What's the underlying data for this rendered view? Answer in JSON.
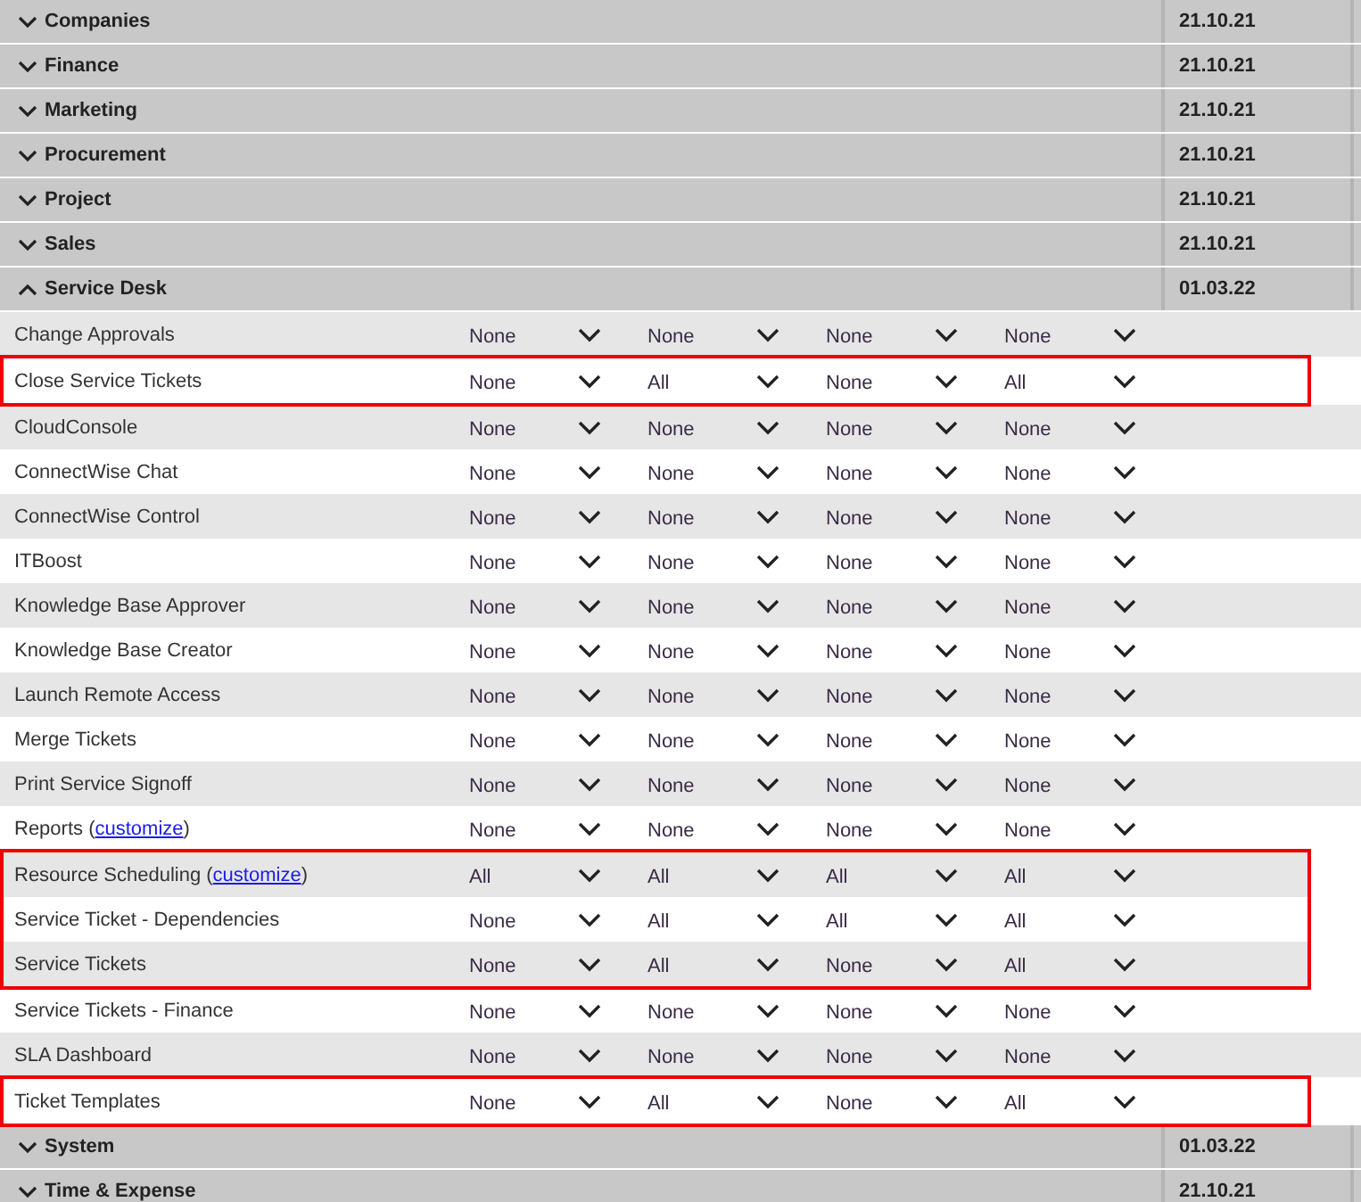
{
  "sections": [
    {
      "title": "Companies",
      "expanded": false,
      "date": "21.10.21"
    },
    {
      "title": "Finance",
      "expanded": false,
      "date": "21.10.21"
    },
    {
      "title": "Marketing",
      "expanded": false,
      "date": "21.10.21"
    },
    {
      "title": "Procurement",
      "expanded": false,
      "date": "21.10.21"
    },
    {
      "title": "Project",
      "expanded": false,
      "date": "21.10.21"
    },
    {
      "title": "Sales",
      "expanded": false,
      "date": "21.10.21"
    },
    {
      "title": "Service Desk",
      "expanded": true,
      "date": "01.03.22",
      "groups": [
        {
          "highlighted": false,
          "rows": [
            {
              "label": "Change Approvals",
              "values": [
                "None",
                "None",
                "None",
                "None"
              ]
            }
          ]
        },
        {
          "highlighted": true,
          "rows": [
            {
              "label": "Close Service Tickets",
              "values": [
                "None",
                "All",
                "None",
                "All"
              ]
            }
          ]
        },
        {
          "highlighted": false,
          "rows": [
            {
              "label": "CloudConsole",
              "values": [
                "None",
                "None",
                "None",
                "None"
              ]
            },
            {
              "label": "ConnectWise Chat",
              "values": [
                "None",
                "None",
                "None",
                "None"
              ]
            },
            {
              "label": "ConnectWise Control",
              "values": [
                "None",
                "None",
                "None",
                "None"
              ]
            },
            {
              "label": "ITBoost",
              "values": [
                "None",
                "None",
                "None",
                "None"
              ]
            },
            {
              "label": "Knowledge Base Approver",
              "values": [
                "None",
                "None",
                "None",
                "None"
              ]
            },
            {
              "label": "Knowledge Base Creator",
              "values": [
                "None",
                "None",
                "None",
                "None"
              ]
            },
            {
              "label": "Launch Remote Access",
              "values": [
                "None",
                "None",
                "None",
                "None"
              ]
            },
            {
              "label": "Merge Tickets",
              "values": [
                "None",
                "None",
                "None",
                "None"
              ]
            },
            {
              "label": "Print Service Signoff",
              "values": [
                "None",
                "None",
                "None",
                "None"
              ]
            },
            {
              "label": "Reports (",
              "link": "customize",
              "label_end": ")",
              "values": [
                "None",
                "None",
                "None",
                "None"
              ]
            }
          ]
        },
        {
          "highlighted": true,
          "rows": [
            {
              "label": "Resource Scheduling (",
              "link": "customize",
              "label_end": ")",
              "values": [
                "All",
                "All",
                "All",
                "All"
              ]
            },
            {
              "label": "Service Ticket - Dependencies",
              "values": [
                "None",
                "All",
                "All",
                "All"
              ]
            },
            {
              "label": "Service Tickets",
              "values": [
                "None",
                "All",
                "None",
                "All"
              ]
            }
          ]
        },
        {
          "highlighted": false,
          "rows": [
            {
              "label": "Service Tickets - Finance",
              "values": [
                "None",
                "None",
                "None",
                "None"
              ]
            },
            {
              "label": "SLA Dashboard",
              "values": [
                "None",
                "None",
                "None",
                "None"
              ]
            }
          ]
        },
        {
          "highlighted": true,
          "rows": [
            {
              "label": "Ticket Templates",
              "values": [
                "None",
                "All",
                "None",
                "All"
              ]
            }
          ]
        }
      ]
    },
    {
      "title": "System",
      "expanded": false,
      "date": "01.03.22"
    },
    {
      "title": "Time & Expense",
      "expanded": false,
      "date": "21.10.21"
    }
  ]
}
